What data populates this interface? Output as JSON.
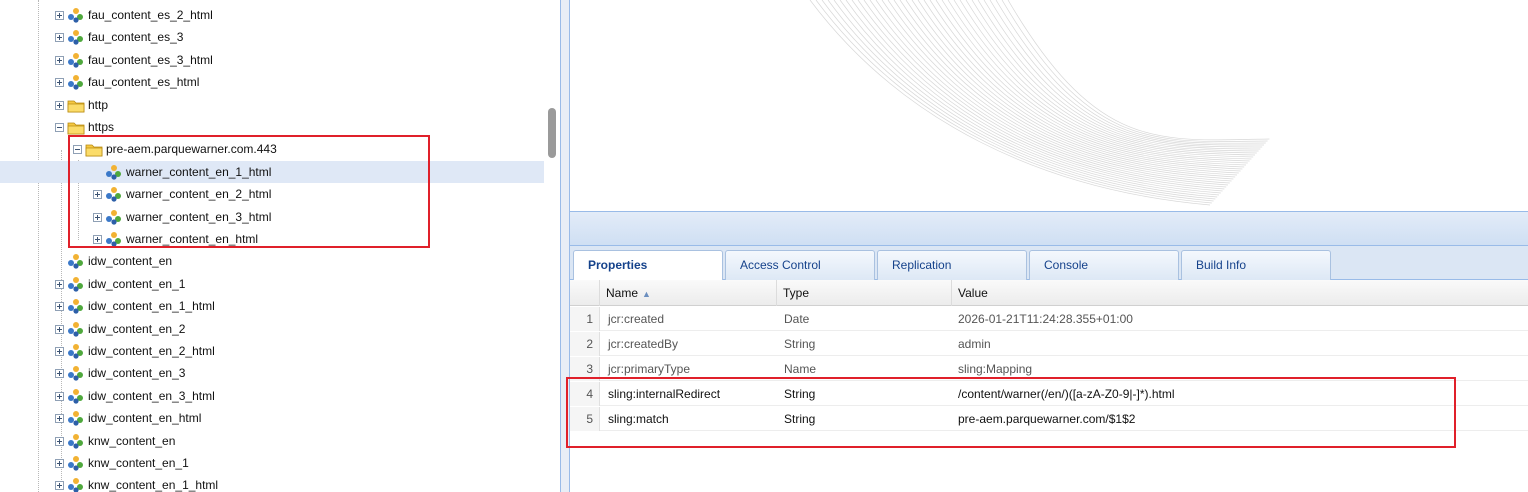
{
  "tree": {
    "nodes": [
      {
        "label": "fau_content_es_2_html",
        "icon": "mapping-node-icon",
        "expander": "plus"
      },
      {
        "label": "fau_content_es_3",
        "icon": "mapping-node-icon",
        "expander": "plus"
      },
      {
        "label": "fau_content_es_3_html",
        "icon": "mapping-node-icon",
        "expander": "plus"
      },
      {
        "label": "fau_content_es_html",
        "icon": "mapping-node-icon",
        "expander": "plus"
      },
      {
        "label": "http",
        "icon": "folder-icon",
        "expander": "plus"
      },
      {
        "label": "https",
        "icon": "folder-icon",
        "expander": "minus"
      },
      {
        "label": "pre-aem.parquewarner.com.443",
        "icon": "folder-icon",
        "expander": "minus"
      },
      {
        "label": "warner_content_en_1_html",
        "icon": "mapping-node-icon",
        "expander": "none"
      },
      {
        "label": "warner_content_en_2_html",
        "icon": "mapping-node-icon",
        "expander": "plus"
      },
      {
        "label": "warner_content_en_3_html",
        "icon": "mapping-node-icon",
        "expander": "plus"
      },
      {
        "label": "warner_content_en_html",
        "icon": "mapping-node-icon",
        "expander": "plus"
      },
      {
        "label": "idw_content_en",
        "icon": "mapping-node-icon",
        "expander": "none"
      },
      {
        "label": "idw_content_en_1",
        "icon": "mapping-node-icon",
        "expander": "plus"
      },
      {
        "label": "idw_content_en_1_html",
        "icon": "mapping-node-icon",
        "expander": "plus"
      },
      {
        "label": "idw_content_en_2",
        "icon": "mapping-node-icon",
        "expander": "plus"
      },
      {
        "label": "idw_content_en_2_html",
        "icon": "mapping-node-icon",
        "expander": "plus"
      },
      {
        "label": "idw_content_en_3",
        "icon": "mapping-node-icon",
        "expander": "plus"
      },
      {
        "label": "idw_content_en_3_html",
        "icon": "mapping-node-icon",
        "expander": "plus"
      },
      {
        "label": "idw_content_en_html",
        "icon": "mapping-node-icon",
        "expander": "plus"
      },
      {
        "label": "knw_content_en",
        "icon": "mapping-node-icon",
        "expander": "plus"
      },
      {
        "label": "knw_content_en_1",
        "icon": "mapping-node-icon",
        "expander": "plus"
      },
      {
        "label": "knw_content_en_1_html",
        "icon": "mapping-node-icon",
        "expander": "plus"
      }
    ],
    "selected_label": "warner_content_en_1_html"
  },
  "tabs": [
    {
      "label": "Properties",
      "active": true
    },
    {
      "label": "Access Control",
      "active": false
    },
    {
      "label": "Replication",
      "active": false
    },
    {
      "label": "Console",
      "active": false
    },
    {
      "label": "Build Info",
      "active": false
    }
  ],
  "grid": {
    "columns": {
      "name": "Name",
      "type": "Type",
      "value": "Value"
    },
    "sort_indicator": "▲",
    "rows": [
      {
        "num": "1",
        "name": "jcr:created",
        "type": "Date",
        "value": "2026-01-21T11:24:28.355+01:00"
      },
      {
        "num": "2",
        "name": "jcr:createdBy",
        "type": "String",
        "value": "admin"
      },
      {
        "num": "3",
        "name": "jcr:primaryType",
        "type": "Name",
        "value": "sling:Mapping"
      },
      {
        "num": "4",
        "name": "sling:internalRedirect",
        "type": "String",
        "value": "/content/warner(/en/)([a-zA-Z0-9|-]*).html"
      },
      {
        "num": "5",
        "name": "sling:match",
        "type": "String",
        "value": "pre-aem.parquewarner.com/$1$2"
      }
    ]
  },
  "colors": {
    "annotation_red": "#e0202a",
    "selection": "#dfe8f6",
    "panel_border": "#99bbe8",
    "tab_text": "#15428b"
  }
}
